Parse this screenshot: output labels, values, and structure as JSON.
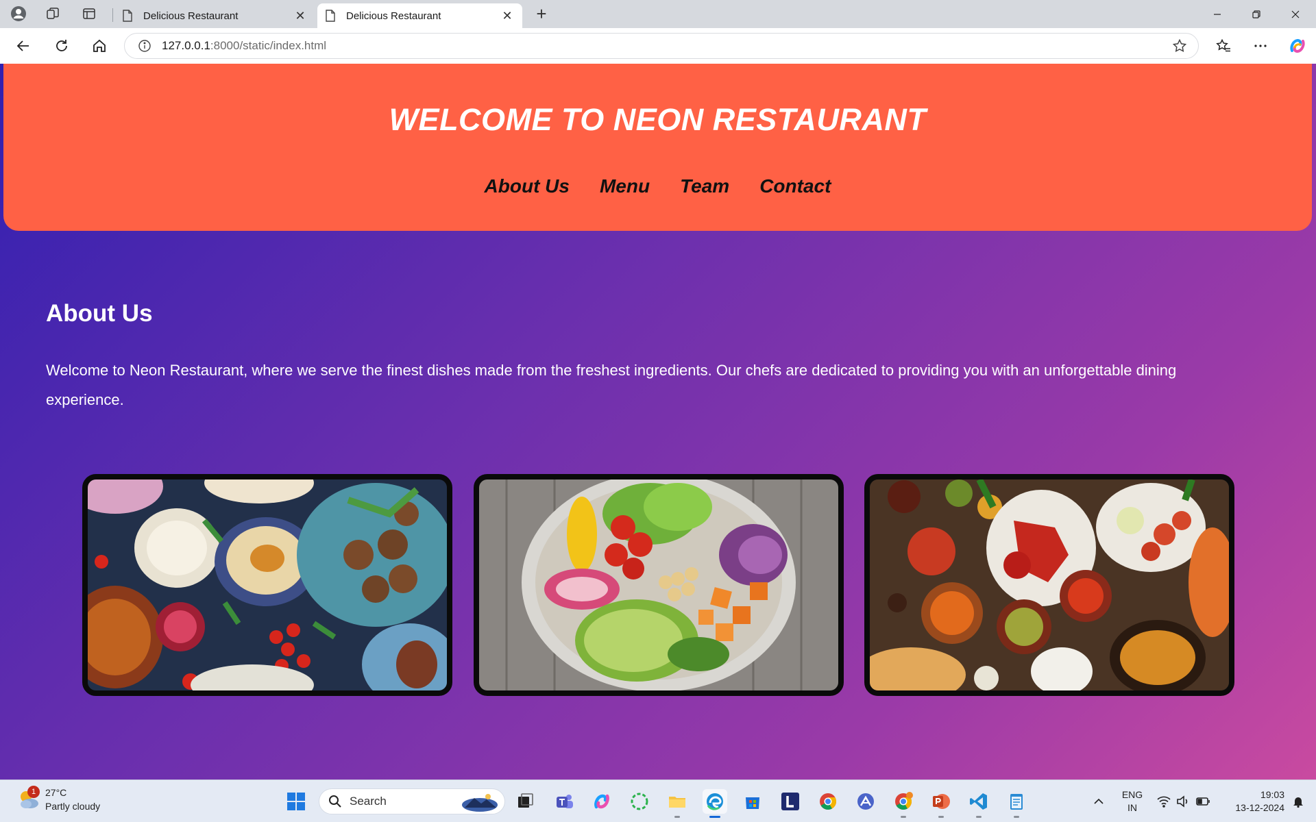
{
  "browser": {
    "tabs": [
      {
        "title": "Delicious Restaurant",
        "active": false
      },
      {
        "title": "Delicious Restaurant",
        "active": true
      }
    ],
    "new_tab_glyph": "+",
    "close_glyph": "✕",
    "url_host": "127.0.0.1",
    "url_rest": ":8000/static/index.html"
  },
  "site": {
    "title": "WELCOME TO NEON RESTAURANT",
    "nav": [
      "About Us",
      "Menu",
      "Team",
      "Contact"
    ],
    "about_heading": "About Us",
    "about_text": "Welcome to Neon Restaurant, where we serve the finest dishes made from the freshest ingredients. Our chefs are dedicated to providing you with an unforgettable dining experience.",
    "gallery": [
      {
        "icon": "mezze-platter-photo"
      },
      {
        "icon": "salad-bowl-photo"
      },
      {
        "icon": "indian-feast-photo"
      }
    ]
  },
  "taskbar": {
    "weather_temp": "27°C",
    "weather_desc": "Partly cloudy",
    "weather_badge": "1",
    "search_label": "Search",
    "lang_line1": "ENG",
    "lang_line2": "IN",
    "time": "19:03",
    "date": "13-12-2024",
    "apps": [
      "start-icon",
      "task-view-icon",
      "teams-icon",
      "copilot-icon",
      "circle-app-icon",
      "file-explorer-icon",
      "edge-icon",
      "store-icon",
      "l-app-icon",
      "chrome-icon",
      "dev-app-icon",
      "chrome-profile-icon",
      "powerpoint-icon",
      "vscode-icon",
      "notepad-icon"
    ]
  },
  "colors": {
    "header": "#ff6145",
    "gradient_start": "#3120b0",
    "gradient_end": "#c94aa0"
  }
}
